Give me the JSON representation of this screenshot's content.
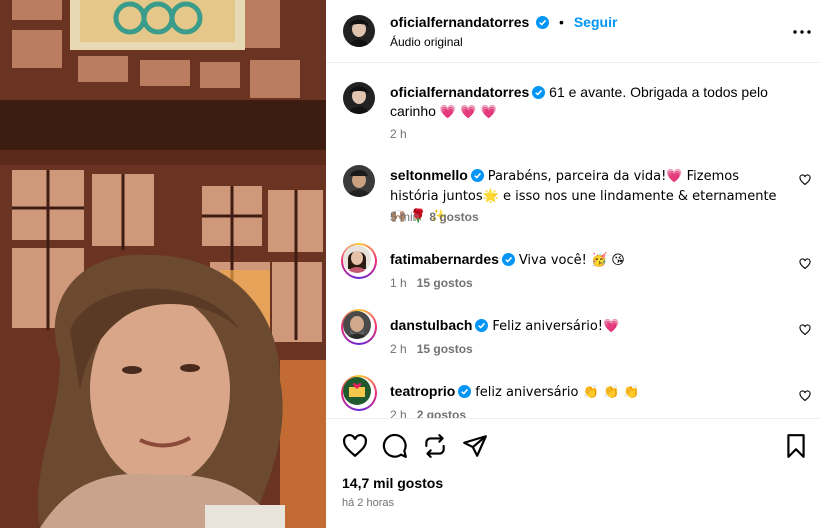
{
  "post": {
    "username": "oficialfernandatorres",
    "separator": "•",
    "follow_label": "Seguir",
    "audio": "Áudio original",
    "caption_user": "oficialfernandatorres",
    "caption_text": "61 e avante. Obrigada a todos pelo carinho",
    "caption_emoji": "💗 💗 💗",
    "caption_time": "2 h"
  },
  "comments": [
    {
      "user": "seltonmello",
      "text": "Parabéns, parceira da vida!💗  Fizemos história juntos🌟 e isso nos une lindamente & eternamente🙌🏽 🌹 ✨",
      "time": "5 min",
      "likes": "8 gostos"
    },
    {
      "user": "fatimabernardes",
      "text": "Viva você! 🥳 😘",
      "time": "1 h",
      "likes": "15 gostos"
    },
    {
      "user": "danstulbach",
      "text": "Feliz aniversário!💗",
      "time": "2 h",
      "likes": "15 gostos"
    },
    {
      "user": "teatroprio",
      "text": "feliz aniversário 👏 👏 👏",
      "time": "2 h",
      "likes": "2 gostos"
    }
  ],
  "footer": {
    "likes": "14,7 mil gostos",
    "posted": "há 2 horas"
  },
  "icons": [
    "verified-icon",
    "more-icon",
    "heart-icon",
    "comment-icon",
    "share-icon",
    "send-icon",
    "save-icon"
  ],
  "colors": {
    "accent": "#0095f6",
    "verified": "#0095f6",
    "muted": "#737373"
  }
}
